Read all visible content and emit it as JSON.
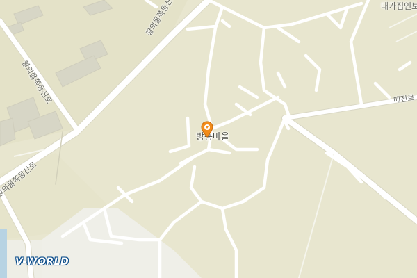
{
  "map": {
    "place_label": "방동마을",
    "road_labels": {
      "dongsan_top": "황의물쪽동산로",
      "dongsan_left": "황의물쪽동산로",
      "dongsan_bottom": "황의물쪽동산로",
      "maejeon": "매전로",
      "corner": "대가집인보"
    },
    "colors": {
      "land": "#e8e6cf",
      "road": "#ffffff",
      "road_edge": "#d9d7c4",
      "building": "#d7d6c6",
      "developed": "#eeeee6",
      "water": "#b7d3e3",
      "marker": "#f28c1a"
    },
    "icons": {
      "marker": "map-pin-icon",
      "logo": "vworld-logo"
    }
  },
  "branding": {
    "logo_text": "V-WORLD"
  }
}
